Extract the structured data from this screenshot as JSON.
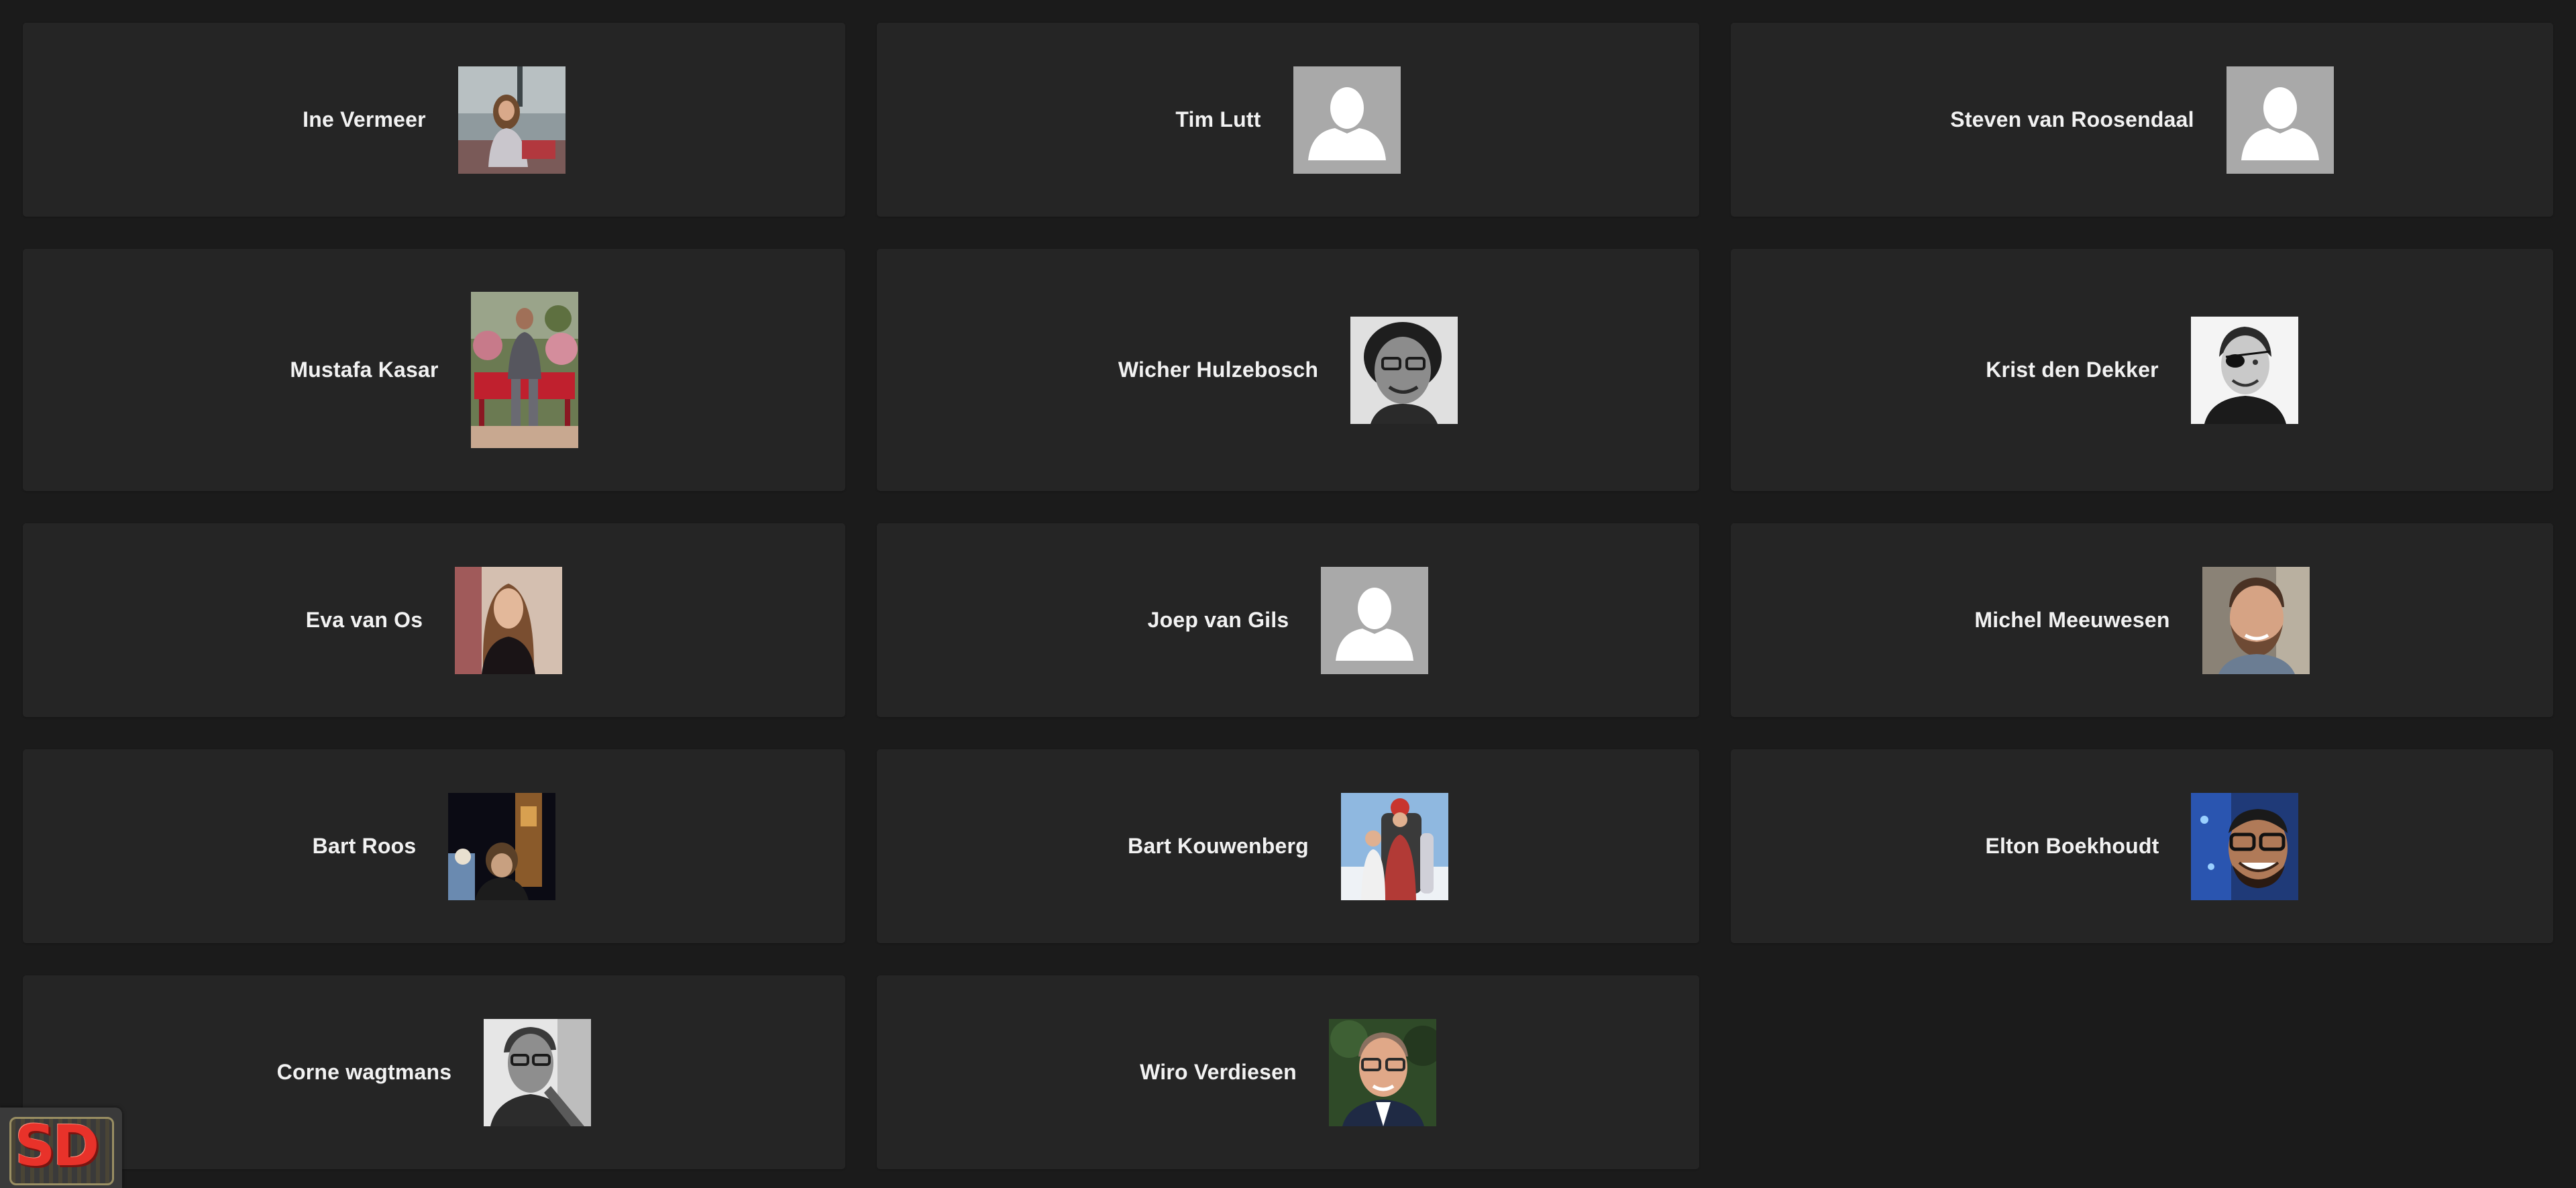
{
  "people": [
    {
      "name": "Ine Vermeer",
      "photo": "photo-woman-seated-outdoors"
    },
    {
      "name": "Tim Lutt",
      "photo": "default-avatar"
    },
    {
      "name": "Steven van Roosendaal",
      "photo": "default-avatar"
    },
    {
      "name": "Mustafa Kasar",
      "photo": "photo-man-on-red-bench"
    },
    {
      "name": "Wicher Hulzebosch",
      "photo": "photo-man-bw-portrait"
    },
    {
      "name": "Krist den Dekker",
      "photo": "photo-man-eyepatch-bw"
    },
    {
      "name": "Eva van Os",
      "photo": "photo-woman-long-hair"
    },
    {
      "name": "Joep van Gils",
      "photo": "default-avatar"
    },
    {
      "name": "Michel Meeuwesen",
      "photo": "photo-man-beard-smiling"
    },
    {
      "name": "Bart Roos",
      "photo": "photo-man-night-tower"
    },
    {
      "name": "Bart Kouwenberg",
      "photo": "photo-two-people-snow"
    },
    {
      "name": "Elton Boekhoudt",
      "photo": "photo-man-glasses-blue"
    },
    {
      "name": "Corne wagtmans",
      "photo": "photo-man-guitar-bw"
    },
    {
      "name": "Wiro Verdiesen",
      "photo": "photo-man-suit-glasses"
    }
  ],
  "badge": {
    "letters": "SD",
    "icon": "sd-logo-chip-icon"
  },
  "colors": {
    "background": "#1b1b1b",
    "card": "#252525",
    "text": "#f2f2f2",
    "default_avatar_bg": "#a9a9a9",
    "badge_red": "#e8322a"
  }
}
